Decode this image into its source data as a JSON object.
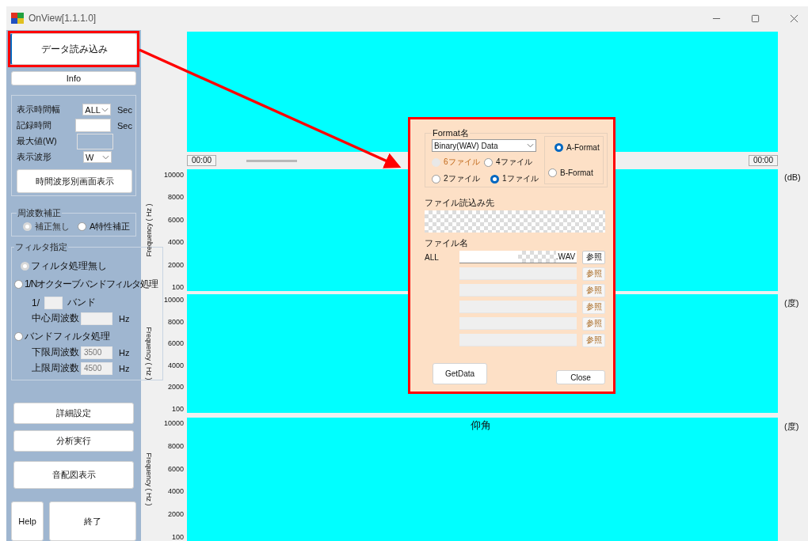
{
  "window": {
    "title": "OnView[1.1.1.0]"
  },
  "sidebar": {
    "load_button": {
      "label": "データ読み込み",
      "highlighted": true
    },
    "info_button": {
      "label": "Info"
    },
    "display_settings": [
      {
        "kind": "select",
        "label": "表示時間幅",
        "value": "ALL",
        "unit": "Sec"
      },
      {
        "kind": "input",
        "label": "記録時間",
        "unit": "Sec"
      },
      {
        "kind": "readonly",
        "label": "最大値(W)"
      },
      {
        "kind": "select",
        "label": "表示波形",
        "value": "W"
      }
    ],
    "waveform_button": {
      "label": "時間波形別画面表示"
    },
    "frequency_correction": {
      "title": "周波数補正",
      "options": [
        {
          "label": "補正無し",
          "selected": true,
          "disabled": true
        },
        {
          "label": "A特性補正",
          "selected": false,
          "disabled": false
        }
      ]
    },
    "filter": {
      "title": "フィルタ指定",
      "items": [
        {
          "kind": "radio",
          "label": "フィルタ処理無し",
          "selected": true,
          "disabled": true
        },
        {
          "kind": "radio",
          "label": "1/Nオクターブバンドフィルタ処理",
          "selected": false,
          "disabled": false
        },
        {
          "kind": "fraction",
          "prefix": "1/",
          "suffix": "バンド"
        },
        {
          "kind": "field",
          "label": "中心周波数",
          "unit": "Hz"
        },
        {
          "kind": "radio",
          "label": "バンドフィルタ処理",
          "selected": false,
          "disabled": false
        },
        {
          "kind": "field",
          "label": "下限周波数",
          "value": "3500",
          "unit": "Hz"
        },
        {
          "kind": "field",
          "label": "上限周波数",
          "value": "4500",
          "unit": "Hz"
        }
      ]
    },
    "action_buttons": [
      "詳細設定",
      "分析実行",
      "音配図表示"
    ],
    "help_button": "Help",
    "exit_button": "終了"
  },
  "main": {
    "overview": {
      "start_time": "00:00",
      "end_time": "00:00"
    },
    "plots": [
      {
        "ylabel": "Frequency ( Hz )",
        "unit": "(dB)",
        "yticks": [
          "10000",
          "8000",
          "6000",
          "4000",
          "2000",
          "100"
        ]
      },
      {
        "ylabel": "Frequency ( Hz )",
        "unit": "(度)",
        "yticks": [
          "10000",
          "8000",
          "6000",
          "4000",
          "2000",
          "100"
        ]
      },
      {
        "ylabel": "Frequency ( Hz )",
        "unit": "(度)",
        "title": "仰角",
        "yticks": [
          "10000",
          "8000",
          "6000",
          "4000",
          "2000",
          "100"
        ]
      }
    ]
  },
  "dialog": {
    "highlighted": true,
    "format_title": "Format名",
    "format_select": "Binary(WAV) Data",
    "file_counts": [
      {
        "label": "6ファイル",
        "selected": false,
        "disabled": true
      },
      {
        "label": "4ファイル",
        "selected": false,
        "disabled": false
      },
      {
        "label": "2ファイル",
        "selected": false,
        "disabled": false
      },
      {
        "label": "1ファイル",
        "selected": true,
        "disabled": false
      }
    ],
    "formats": [
      {
        "label": "A-Format",
        "selected": true
      },
      {
        "label": "B-Format",
        "selected": false
      }
    ],
    "source_label": "ファイル読込み先",
    "source_redacted": true,
    "filename_label": "ファイル名",
    "files": [
      {
        "label": "ALL",
        "value": ".WAV",
        "redacted": true,
        "disabled": false,
        "browse": "参照"
      },
      {
        "disabled": true,
        "browse": "参照"
      },
      {
        "disabled": true,
        "browse": "参照"
      },
      {
        "disabled": true,
        "browse": "参照"
      },
      {
        "disabled": true,
        "browse": "参照"
      },
      {
        "disabled": true,
        "browse": "参照"
      }
    ],
    "get_button": "GetData",
    "close_button": "Close"
  }
}
